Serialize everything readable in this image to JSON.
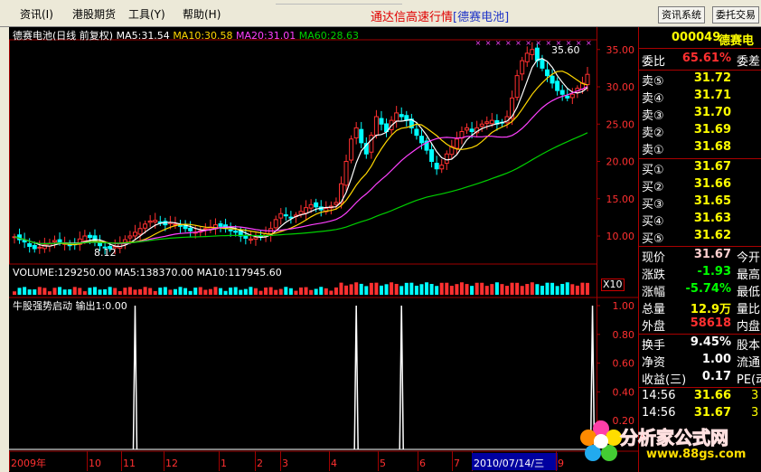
{
  "menu": {
    "items": [
      "资讯(I)",
      "港股期货",
      "工具(Y)",
      "帮助(H)"
    ],
    "app_title": "通达信高速行情",
    "stock_name": "[德赛电池]",
    "btn_info": "资讯系统",
    "btn_trade": "委托交易"
  },
  "chart": {
    "title": "德赛电池(日线 前复权)",
    "ma5": "MA5:31.54",
    "ma10": "MA10:30.58",
    "ma20": "MA20:31.01",
    "ma60": "MA60:28.63",
    "yaxis": [
      "35.00",
      "30.00",
      "25.00",
      "20.00",
      "15.00",
      "10.00"
    ],
    "high_label": "35.60",
    "low_label": "8.12",
    "colors": {
      "ma5": "#ffffff",
      "ma10": "#ffd700",
      "ma20": "#ff40ff",
      "ma60": "#00d000",
      "up": "#ff3030",
      "down": "#00ffff"
    },
    "closes": [
      9.9,
      9.5,
      9.2,
      8.6,
      8.3,
      8.5,
      8.8,
      9.0,
      9.4,
      9.2,
      9.0,
      8.7,
      8.9,
      9.6,
      10.0,
      9.8,
      9.3,
      8.7,
      8.4,
      8.3,
      8.6,
      9.0,
      9.5,
      10.0,
      10.5,
      11.0,
      11.6,
      12.0,
      12.1,
      11.8,
      11.5,
      11.8,
      11.6,
      11.3,
      11.0,
      10.7,
      10.5,
      10.7,
      11.0,
      11.2,
      11.5,
      11.3,
      11.0,
      10.8,
      10.5,
      10.0,
      9.7,
      9.6,
      9.8,
      10.0,
      10.3,
      11.0,
      12.2,
      13.0,
      12.7,
      12.4,
      12.8,
      13.3,
      13.8,
      14.2,
      13.9,
      13.5,
      13.7,
      14.0,
      14.5,
      17.0,
      20.0,
      23.0,
      24.5,
      22.5,
      21.0,
      23.5,
      26.0,
      25.0,
      24.0,
      25.5,
      26.5,
      26.0,
      25.5,
      24.5,
      23.5,
      22.5,
      21.5,
      20.0,
      19.0,
      19.5,
      21.0,
      22.0,
      23.0,
      24.0,
      24.5,
      24.0,
      24.5,
      25.0,
      25.3,
      25.5,
      25.0,
      25.2,
      26.0,
      28.5,
      31.5,
      33.5,
      34.5,
      35.0,
      33.5,
      32.5,
      31.5,
      30.5,
      29.5,
      29.0,
      28.5,
      29.0,
      29.8,
      30.5,
      31.67
    ],
    "volume_label": "VOLUME:129250.00",
    "vol_ma5": "MA5:138370.00",
    "vol_ma10": "MA10:117945.60",
    "indicator_label": "牛股强势启动 输出1:0.00",
    "ind_yaxis": [
      "1.00",
      "0.80",
      "0.60",
      "0.40",
      "0.20"
    ],
    "signals": [
      24,
      68,
      77,
      115
    ],
    "x10": "X10",
    "timeline": [
      "2009年",
      "10",
      "11",
      "12",
      "1",
      "2",
      "3",
      "4",
      "5",
      "6",
      "7",
      "2010/07/14/三",
      "9"
    ]
  },
  "quote": {
    "code": "000049",
    "name": "德赛电",
    "weibi_label": "委比",
    "weibi_value": "65.61%",
    "weicha_label": "委差",
    "sells": [
      {
        "label": "卖⑤",
        "price": "31.72"
      },
      {
        "label": "卖④",
        "price": "31.71"
      },
      {
        "label": "卖③",
        "price": "31.70"
      },
      {
        "label": "卖②",
        "price": "31.69"
      },
      {
        "label": "卖①",
        "price": "31.68"
      }
    ],
    "buys": [
      {
        "label": "买①",
        "price": "31.67"
      },
      {
        "label": "买②",
        "price": "31.66"
      },
      {
        "label": "买③",
        "price": "31.65"
      },
      {
        "label": "买④",
        "price": "31.63"
      },
      {
        "label": "买⑤",
        "price": "31.62"
      }
    ],
    "stats": [
      {
        "label": "现价",
        "value": "31.67",
        "right": "今开",
        "color": "#ffd0d0"
      },
      {
        "label": "涨跌",
        "value": "-1.93",
        "right": "最高",
        "color": "#00ff00"
      },
      {
        "label": "涨幅",
        "value": "-5.74%",
        "right": "最低",
        "color": "#00ff00"
      },
      {
        "label": "总量",
        "value": "12.9万",
        "right": "量比",
        "color": "#ffff00"
      },
      {
        "label": "外盘",
        "value": "58618",
        "right": "内盘",
        "color": "#ff3030"
      }
    ],
    "stats2": [
      {
        "label": "换手",
        "value": "9.45%",
        "right": "股本"
      },
      {
        "label": "净资",
        "value": "1.00",
        "right": "流通"
      },
      {
        "label": "收益(三)",
        "value": "0.17",
        "right": "PE(动"
      }
    ],
    "ticks": [
      {
        "time": "14:56",
        "price": "31.66",
        "right": "3"
      },
      {
        "time": "14:56",
        "price": "31.67",
        "right": "3"
      }
    ]
  },
  "watermark": {
    "title": "分析家公式网",
    "url": "www.88gs.com"
  }
}
